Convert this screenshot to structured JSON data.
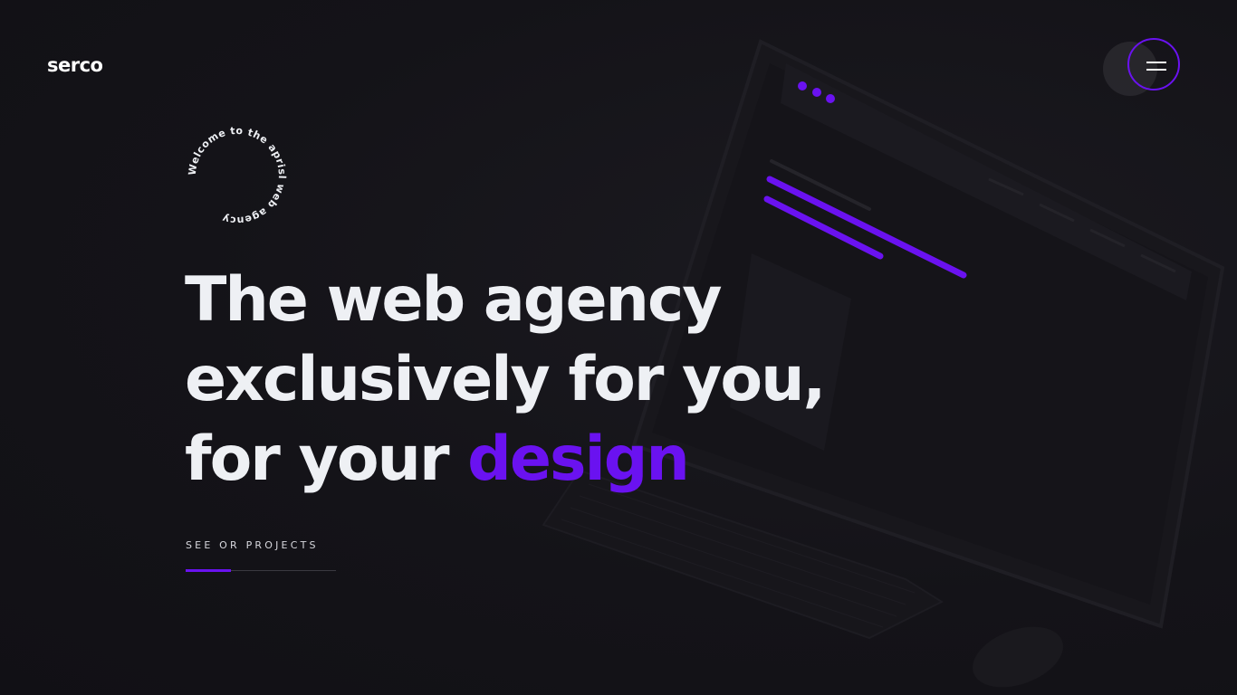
{
  "brand": {
    "logo": "serco"
  },
  "menu": {
    "icon": "hamburger-menu-icon"
  },
  "badge": {
    "text": "Welcome to the aprisl web agency"
  },
  "hero": {
    "line1": "The web agency",
    "line2": "exclusively for you,",
    "line3_prefix": "for your ",
    "line3_accent": "design"
  },
  "cta": {
    "label": "SEE OR PROJECTS"
  },
  "colors": {
    "accent": "#6a12f0",
    "background": "#141318",
    "text": "#eef0f4"
  }
}
